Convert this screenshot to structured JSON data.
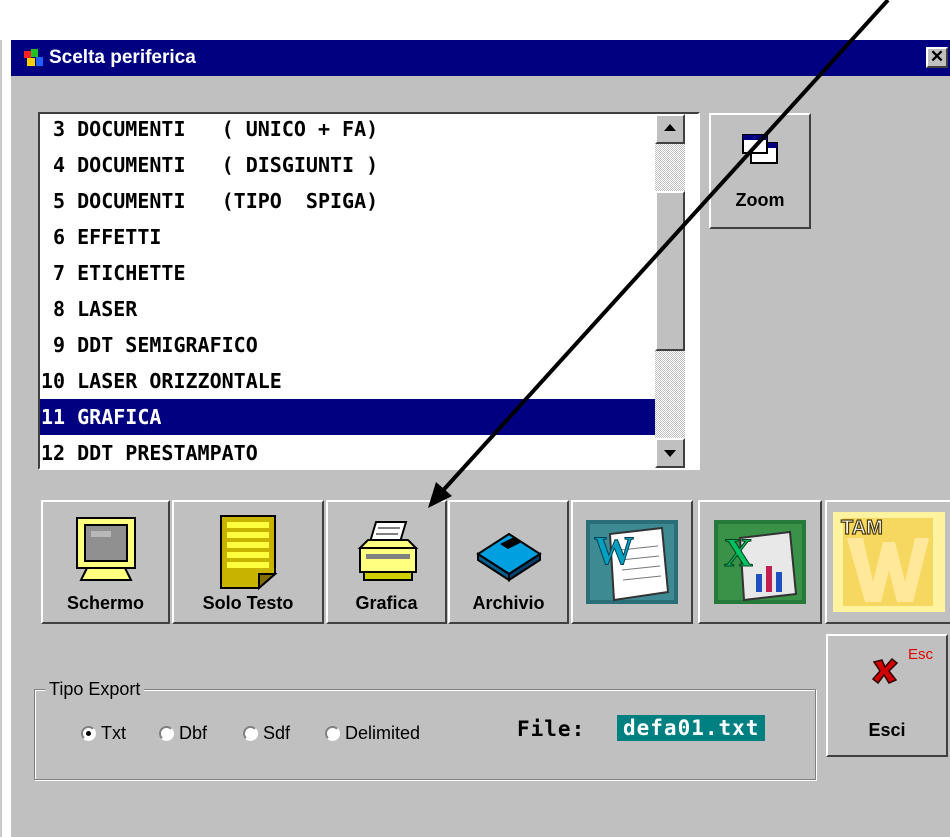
{
  "window": {
    "title": "Scelta periferica",
    "close_symbol": "✕"
  },
  "list": {
    "items": [
      {
        "number": " 3",
        "text": "DOCUMENTI   ( UNICO + FA)"
      },
      {
        "number": " 4",
        "text": "DOCUMENTI   ( DISGIUNTI )"
      },
      {
        "number": " 5",
        "text": "DOCUMENTI   (TIPO  SPIGA)"
      },
      {
        "number": " 6",
        "text": "EFFETTI"
      },
      {
        "number": " 7",
        "text": "ETICHETTE"
      },
      {
        "number": " 8",
        "text": "LASER"
      },
      {
        "number": " 9",
        "text": "DDT SEMIGRAFICO"
      },
      {
        "number": "10",
        "text": "LASER ORIZZONTALE"
      },
      {
        "number": "11",
        "text": "GRAFICA"
      },
      {
        "number": "12",
        "text": "DDT PRESTAMPATO"
      }
    ],
    "selected_index": 8
  },
  "zoom_button": {
    "label": "Zoom",
    "icon": "windows-zoom-icon"
  },
  "output_buttons": [
    {
      "label": "Schermo",
      "icon": "monitor-icon"
    },
    {
      "label": "Solo Testo",
      "icon": "text-page-icon"
    },
    {
      "label": "Grafica",
      "icon": "printer-icon"
    },
    {
      "label": "Archivio",
      "icon": "floppy-disk-icon"
    },
    {
      "label": "",
      "icon": "word-icon"
    },
    {
      "label": "",
      "icon": "excel-icon"
    },
    {
      "label": "",
      "icon": "tam-wp-icon",
      "logo_text": "TAM"
    }
  ],
  "esci_button": {
    "label": "Esci",
    "shortcut": "Esc",
    "icon": "red-x-icon"
  },
  "export": {
    "legend": "Tipo Export",
    "options": [
      "Txt",
      "Dbf",
      "Sdf",
      "Delimited"
    ],
    "selected": "Txt",
    "file_label": "File:",
    "file_value": "defa01.txt"
  },
  "colors": {
    "titlebar": "#000080",
    "selection": "#000080",
    "file_field": "#008080",
    "window_face": "#c0c0c0"
  }
}
